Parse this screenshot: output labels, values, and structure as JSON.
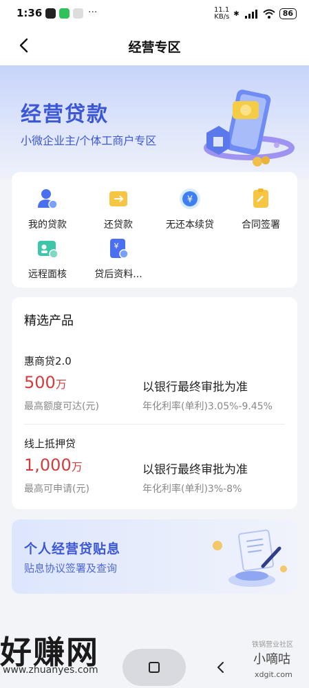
{
  "status_bar": {
    "time": "1:36",
    "network_speed_top": "11.1",
    "network_speed_bottom": "KB/s",
    "battery": "86"
  },
  "nav": {
    "title": "经营专区"
  },
  "banner": {
    "title": "经营贷款",
    "subtitle": "小微企业主/个体工商户专区"
  },
  "services": [
    {
      "label": "我的贷款",
      "icon": "user-loan-icon"
    },
    {
      "label": "还贷款",
      "icon": "repay-icon"
    },
    {
      "label": "无还本续贷",
      "icon": "yuan-renew-icon"
    },
    {
      "label": "合同签署",
      "icon": "contract-sign-icon"
    },
    {
      "label": "远程面核",
      "icon": "remote-verify-icon"
    },
    {
      "label": "贷后资料...",
      "icon": "post-loan-docs-icon"
    }
  ],
  "products": {
    "section_title": "精选产品",
    "items": [
      {
        "name": "惠商贷2.0",
        "amount": "500",
        "unit": "万",
        "amount_note": "最高额度可达(元)",
        "approval": "以银行最终审批为准",
        "rate": "年化利率(单利)3.05%-9.45%"
      },
      {
        "name": "线上抵押贷",
        "amount": "1,000",
        "unit": "万",
        "amount_note": "最高可申请(元)",
        "approval": "以银行最终审批为准",
        "rate": "年化利率(单利)3%-8%"
      }
    ]
  },
  "subsidy": {
    "title": "个人经营贷贴息",
    "desc": "贴息协议签署及查询"
  },
  "watermarks": {
    "left_big": "好赚网",
    "left_url": "www.zhuanyes.com",
    "right_small": "小嘀咕",
    "right_url": "xdgit.com",
    "right_tiny": "铁锅营业社区"
  },
  "colors": {
    "brand_blue": "#3c57d6",
    "amount_red": "#d23c3c"
  }
}
